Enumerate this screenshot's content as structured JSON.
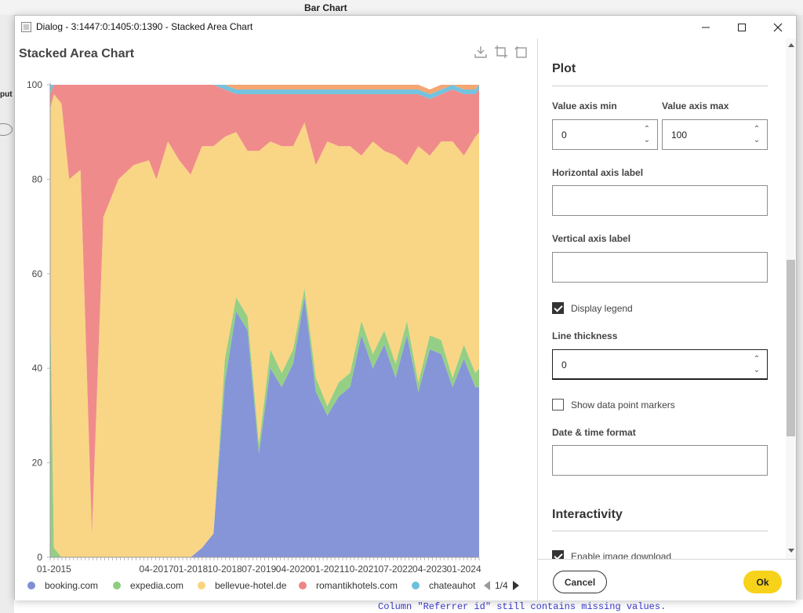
{
  "background": {
    "title": "Bar Chart",
    "left_fragment": "put",
    "console_text": "Column \"Referrer id\" still contains missing values."
  },
  "window": {
    "title": "Dialog - 3:1447:0:1405:0:1390 - Stacked Area Chart",
    "controls": [
      "minimize-icon",
      "maximize-icon",
      "close-icon"
    ]
  },
  "chart_toolbar": [
    "download-icon",
    "crop-icon",
    "reset-zoom-icon"
  ],
  "chart_data": {
    "type": "area",
    "title": "Stacked Area Chart",
    "xlabel": "",
    "ylabel": "",
    "ylim": [
      0,
      100
    ],
    "y_ticks": [
      0,
      20,
      40,
      60,
      80,
      100
    ],
    "x_tick_labels": [
      "01-2015",
      "04-2017",
      "01-2018",
      "10-2018",
      "07-2019",
      "04-2020",
      "01-2021",
      "10-2021",
      "07-2022",
      "04-2023",
      "01-2024"
    ],
    "x": [
      "2014-12",
      "2015-01",
      "2015-03",
      "2015-05",
      "2015-08",
      "2015-11",
      "2016-02",
      "2016-06",
      "2016-10",
      "2017-02",
      "2017-04",
      "2017-07",
      "2017-10",
      "2018-01",
      "2018-04",
      "2018-07",
      "2018-10",
      "2019-01",
      "2019-04",
      "2019-07",
      "2019-10",
      "2020-01",
      "2020-04",
      "2020-07",
      "2020-10",
      "2021-01",
      "2021-04",
      "2021-07",
      "2021-10",
      "2022-01",
      "2022-04",
      "2022-07",
      "2022-10",
      "2023-01",
      "2023-04",
      "2023-07",
      "2023-10",
      "2024-01",
      "2024-04",
      "2024-05"
    ],
    "series": [
      {
        "name": "booking.com",
        "color": "#7f8fd6",
        "values": [
          0,
          0,
          0,
          0,
          0,
          0,
          0,
          0,
          0,
          0,
          0,
          0,
          0,
          0,
          2,
          5,
          37,
          52,
          48,
          22,
          40,
          36,
          41,
          55,
          35,
          30,
          34,
          36,
          47,
          40,
          45,
          38,
          47,
          35,
          44,
          43,
          36,
          42,
          36,
          36
        ]
      },
      {
        "name": "expedia.com",
        "color": "#8fcc80",
        "values": [
          55,
          2,
          0,
          0,
          0,
          0,
          0,
          0,
          0,
          0,
          0,
          0,
          0,
          0,
          0,
          0,
          5,
          3,
          3,
          2,
          4,
          3,
          3,
          2,
          3,
          2,
          3,
          3,
          3,
          3,
          3,
          3,
          3,
          2,
          3,
          3,
          2,
          3,
          3,
          4
        ]
      },
      {
        "name": "bellevue-hotel.de",
        "color": "#f9d47e",
        "values": [
          40,
          96,
          96,
          80,
          82,
          5,
          72,
          80,
          83,
          84,
          80,
          88,
          84,
          81,
          85,
          82,
          47,
          35,
          35,
          62,
          44,
          48,
          43,
          35,
          45,
          56,
          50,
          48,
          35,
          45,
          38,
          44,
          33,
          50,
          38,
          42,
          50,
          40,
          50,
          50
        ]
      },
      {
        "name": "romantikhotels.com",
        "color": "#ef8585",
        "values": [
          3,
          2,
          4,
          20,
          18,
          95,
          28,
          20,
          17,
          16,
          20,
          12,
          16,
          19,
          13,
          13,
          10,
          8,
          12,
          12,
          10,
          11,
          11,
          6,
          15,
          10,
          11,
          11,
          13,
          10,
          12,
          13,
          15,
          11,
          12,
          10,
          11,
          13,
          9,
          9
        ]
      },
      {
        "name": "chateauhot",
        "color": "#6cc0dd",
        "values": [
          2,
          0,
          0,
          0,
          0,
          0,
          0,
          0,
          0,
          0,
          0,
          0,
          0,
          0,
          0,
          0,
          1,
          1,
          1,
          1,
          1,
          1,
          1,
          1,
          1,
          1,
          1,
          1,
          1,
          1,
          1,
          1,
          1,
          1,
          1,
          1,
          1,
          1,
          1,
          1
        ]
      },
      {
        "name": "",
        "color": "#f4a06a",
        "values": [
          0,
          0,
          0,
          0,
          0,
          0,
          0,
          0,
          0,
          0,
          0,
          0,
          0,
          0,
          0,
          0,
          0,
          1,
          1,
          1,
          1,
          1,
          1,
          1,
          1,
          1,
          1,
          1,
          1,
          1,
          1,
          1,
          1,
          1,
          1,
          1,
          0,
          1,
          1,
          0
        ]
      }
    ],
    "legend": {
      "position": "bottom",
      "page": "1/4"
    }
  },
  "settings": {
    "plot_title": "Plot",
    "value_axis_min_label": "Value axis min",
    "value_axis_min": "0",
    "value_axis_max_label": "Value axis max",
    "value_axis_max": "100",
    "horizontal_axis_label": "Horizontal axis label",
    "horizontal_axis_value": "",
    "vertical_axis_label": "Vertical axis label",
    "vertical_axis_value": "",
    "display_legend_label": "Display legend",
    "display_legend": true,
    "line_thickness_label": "Line thickness",
    "line_thickness": "0",
    "show_markers_label": "Show data point markers",
    "show_markers": false,
    "datetime_format_label": "Date & time format",
    "datetime_format": "",
    "interactivity_title": "Interactivity",
    "enable_download_label": "Enable image download",
    "enable_download": true
  },
  "footer": {
    "cancel_label": "Cancel",
    "ok_label": "Ok",
    "ok_color": "#f7d21b"
  }
}
